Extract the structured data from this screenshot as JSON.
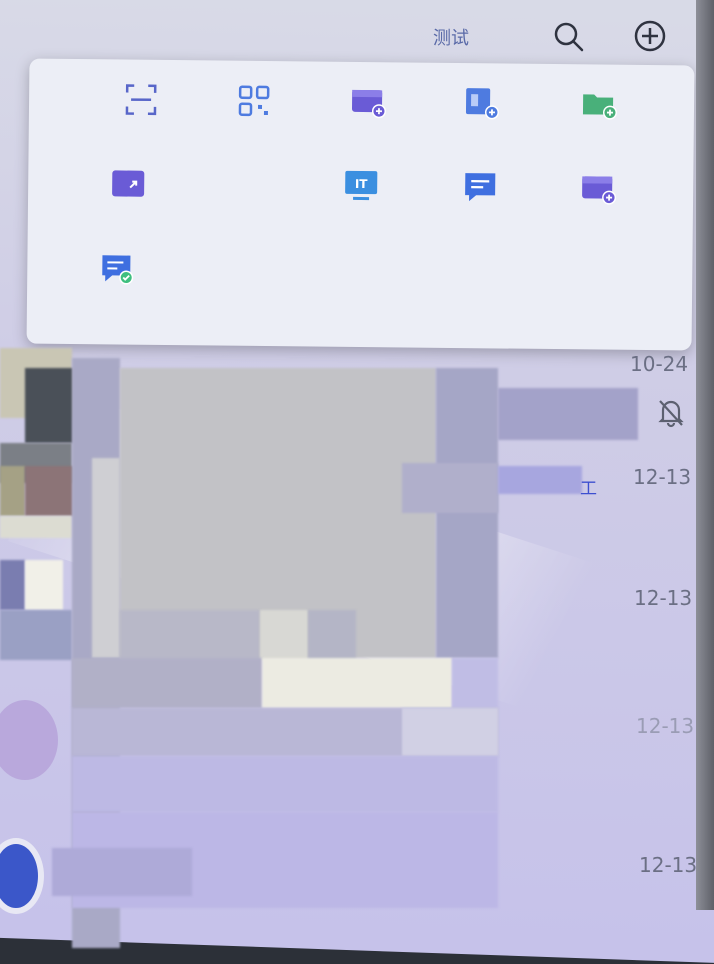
{
  "header": {
    "title": "测试",
    "search_icon": "search-icon",
    "add_icon": "plus-circle-icon"
  },
  "popup_menu": {
    "items": [
      {
        "icon": "scan-icon",
        "label": "",
        "color": "#5866c9"
      },
      {
        "icon": "qr-code-icon",
        "label": "",
        "color": "#4e7be0"
      },
      {
        "icon": "add-calendar-icon",
        "label": "",
        "color": "#6a5bd6"
      },
      {
        "icon": "add-room-icon",
        "label": "",
        "color": "#4e7be0"
      },
      {
        "icon": "add-folder-icon",
        "label": "",
        "color": "#49b07a"
      },
      {
        "icon": "video-meeting-icon",
        "label": "",
        "color": "#6a5bd6"
      },
      {
        "icon": "",
        "label": "",
        "color": ""
      },
      {
        "icon": "it-monitor-icon",
        "label": "",
        "color": "#3b8fe0"
      },
      {
        "icon": "chat-bubble-icon",
        "label": "",
        "color": "#3f6fe0"
      },
      {
        "icon": "calendar-add-icon",
        "label": "",
        "color": "#6a5bd6"
      },
      {
        "icon": "verified-message-icon",
        "label": "",
        "color": "#3f6fe0"
      }
    ]
  },
  "conversation_list": {
    "rows": [
      {
        "date": "10-24",
        "muted": true
      },
      {
        "date": "12-13",
        "badge": "工"
      },
      {
        "date": "12-13"
      },
      {
        "date": "12-13"
      },
      {
        "date": "12-13"
      }
    ]
  },
  "colors": {
    "accent": "#5a6aa8",
    "popup_bg": "#eceef6",
    "screen_bg": "#cfcde6"
  }
}
